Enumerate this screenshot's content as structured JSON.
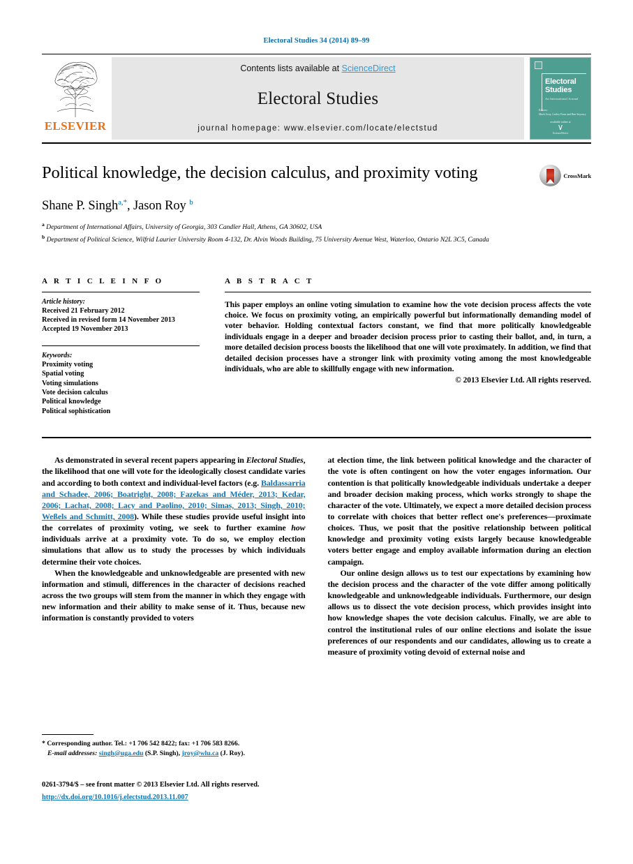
{
  "running_head": "Electoral Studies 34 (2014) 89–99",
  "masthead": {
    "contents_prefix": "Contents lists available at ",
    "sciencedirect": "ScienceDirect",
    "journal_name": "Electoral Studies",
    "homepage": "journal homepage: www.elsevier.com/locate/electstud",
    "publisher": "ELSEVIER",
    "cover": {
      "title_line1": "Electoral",
      "title_line2": "Studies",
      "subtitle": "An International Journal",
      "editors": "Editors:\nMark Gray, Lesley Fenn and Ben Seyoury",
      "publisher_note": "available online at",
      "publisher_logo": "ScienceDirect"
    }
  },
  "article": {
    "title": "Political knowledge, the decision calculus, and proximity voting",
    "authors_html": "Shane P. Singh<sup class=\"aff\">a</sup><sup class=\"star\">,*</sup>, Jason Roy <sup class=\"aff\">b</sup>",
    "author_names": [
      "Shane P. Singh",
      "Jason Roy"
    ],
    "affiliations": [
      {
        "label": "a",
        "text": "Department of International Affairs, University of Georgia, 303 Candler Hall, Athens, GA 30602, USA"
      },
      {
        "label": "b",
        "text": "Department of Political Science, Wilfrid Laurier University Room 4-132, Dr. Alvin Woods Building, 75 University Avenue West, Waterloo, Ontario N2L 3C5, Canada"
      }
    ],
    "crossmark_label": "CrossMark"
  },
  "info": {
    "heading": "A R T I C L E  I N F O",
    "history_label": "Article history:",
    "history": [
      "Received 21 February 2012",
      "Received in revised form 14 November 2013",
      "Accepted 19 November 2013"
    ],
    "keywords_label": "Keywords:",
    "keywords": [
      "Proximity voting",
      "Spatial voting",
      "Voting simulations",
      "Vote decision calculus",
      "Political knowledge",
      "Political sophistication"
    ]
  },
  "abstract": {
    "heading": "A B S T R A C T",
    "text": "This paper employs an online voting simulation to examine how the vote decision process affects the vote choice. We focus on proximity voting, an empirically powerful but informationally demanding model of voter behavior. Holding contextual factors constant, we find that more politically knowledgeable individuals engage in a deeper and broader decision process prior to casting their ballot, and, in turn, a more detailed decision process boosts the likelihood that one will vote proximately. In addition, we find that detailed decision processes have a stronger link with proximity voting among the most knowledgeable individuals, who are able to skillfully engage with new information.",
    "copyright": "© 2013 Elsevier Ltd. All rights reserved."
  },
  "body": {
    "left": {
      "p1_a": "As demonstrated in several recent papers appearing in ",
      "p1_em": "Electoral Studies",
      "p1_b": ", the likelihood that one will vote for the ideologically closest candidate varies and according to both context and individual-level factors (e.g. ",
      "p1_cite": "Baldassarria and Schadee, 2006; Boatright, 2008; Fazekas and Méder, 2013; Kedar, 2006; Lachat, 2008; Lacy and Paolino, 2010; Simas, 2013; Singh, 2010; Weßels and Schmitt, 2008",
      "p1_c": "). While these studies provide useful insight into the correlates of proximity voting, we seek to further examine ",
      "p1_em2": "how",
      "p1_d": " individuals arrive at a proximity vote. To do so, we employ election simulations that allow us to study the processes by which individuals determine their vote choices.",
      "p2": "When the knowledgeable and unknowledgeable are presented with new information and stimuli, differences in the character of decisions reached across the two groups will stem from the manner in which they engage with new information and their ability to make sense of it. Thus, because new information is constantly provided to voters"
    },
    "right": {
      "p1": "at election time, the link between political knowledge and the character of the vote is often contingent on how the voter engages information. Our contention is that politically knowledgeable individuals undertake a deeper and broader decision making process, which works strongly to shape the character of the vote. Ultimately, we expect a more detailed decision process to correlate with choices that better reflect one's preferences—proximate choices. Thus, we posit that the positive relationship between political knowledge and proximity voting exists largely because knowledgeable voters better engage and employ available information during an election campaign.",
      "p2": "Our online design allows us to test our expectations by examining how the decision process and the character of the vote differ among politically knowledgeable and unknowledgeable individuals. Furthermore, our design allows us to dissect the vote decision process, which provides insight into how knowledge shapes the vote decision calculus. Finally, we are able to control the institutional rules of our online elections and isolate the issue preferences of our respondents and our candidates, allowing us to create a measure of proximity voting devoid of external noise and"
    }
  },
  "footnote": {
    "marker": "*",
    "corresponding": " Corresponding author. Tel.: +1 706 542 8422; fax: +1 706 583 8266.",
    "email_label": "E-mail addresses:",
    "email1": "singh@uga.edu",
    "email1_name": " (S.P. Singh), ",
    "email2": "jroy@wlu.ca",
    "email2_name": " (J. Roy)."
  },
  "footer": {
    "issn_line": "0261-3794/$ – see front matter © 2013 Elsevier Ltd. All rights reserved.",
    "doi": "http://dx.doi.org/10.1016/j.electstud.2013.11.007"
  },
  "colors": {
    "link": "#1076b5",
    "sciencedirect": "#2e9bd6",
    "runhead": "#0a6ca8",
    "elsevier_orange": "#e8711a",
    "cover_teal": "#4f9e92"
  }
}
